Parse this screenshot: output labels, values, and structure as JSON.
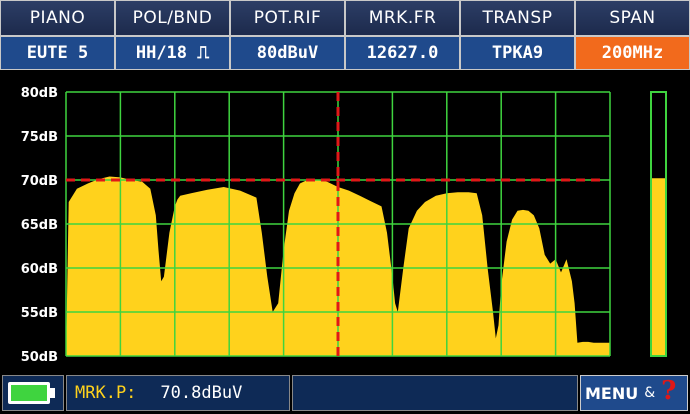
{
  "header": {
    "labels": [
      "PIANO",
      "POL/BND",
      "POT.RIF",
      "MRK.FR",
      "TRANSP",
      "SPAN"
    ],
    "values": [
      "EUTE 5",
      "HH/18 ⎍",
      "80dBuV",
      "12627.0",
      "TPKA9",
      "200MHz"
    ],
    "active_index": 5
  },
  "colors": {
    "active": "#f26a1c",
    "trace": "#ffd21c",
    "grid": "#3fd43f",
    "reference": "#e01818",
    "level_bar": "#ffd21c",
    "battery": "#3fd43f"
  },
  "chart_data": {
    "type": "area",
    "ylim": [
      50,
      80
    ],
    "ytick_labels": [
      "80dB",
      "75dB",
      "70dB",
      "65dB",
      "60dB",
      "55dB",
      "50dB"
    ],
    "yticks": [
      80,
      75,
      70,
      65,
      60,
      55,
      50
    ],
    "x_grid_divisions": 10,
    "reference_level": 70,
    "marker_position": 0.5,
    "level_bar_value": 70.2,
    "grid": true,
    "series": [
      {
        "x": [
          0,
          0.005,
          0.02,
          0.04,
          0.06,
          0.08,
          0.1,
          0.12,
          0.14,
          0.155,
          0.165,
          0.17,
          0.175,
          0.18,
          0.19,
          0.2,
          0.205,
          0.21,
          0.23,
          0.26,
          0.29,
          0.32,
          0.35,
          0.36,
          0.37,
          0.38,
          0.39,
          0.4,
          0.41,
          0.42,
          0.43,
          0.44,
          0.46,
          0.48,
          0.49,
          0.5,
          0.52,
          0.54,
          0.56,
          0.58,
          0.59,
          0.6,
          0.605,
          0.61,
          0.62,
          0.63,
          0.645,
          0.66,
          0.68,
          0.7,
          0.72,
          0.74,
          0.755,
          0.765,
          0.775,
          0.785,
          0.79,
          0.795,
          0.8,
          0.81,
          0.82,
          0.83,
          0.84,
          0.85,
          0.86,
          0.87,
          0.88,
          0.89,
          0.9,
          0.91,
          0.92,
          0.93,
          0.935,
          0.94,
          0.95,
          0.96,
          0.97,
          0.98,
          0.99,
          1.0
        ],
        "y": [
          50,
          67.5,
          69.0,
          69.6,
          70.1,
          70.4,
          70.3,
          70.0,
          69.8,
          69.0,
          66.0,
          62.0,
          58.5,
          59.0,
          64.0,
          67.0,
          67.8,
          68.2,
          68.5,
          68.9,
          69.2,
          68.8,
          68.0,
          64.0,
          59.0,
          55.0,
          56.0,
          62.0,
          66.5,
          68.5,
          69.6,
          69.9,
          70.0,
          69.8,
          69.5,
          69.2,
          68.8,
          68.2,
          67.6,
          67.0,
          64.0,
          59.0,
          56.0,
          55.0,
          60.0,
          64.5,
          66.5,
          67.5,
          68.2,
          68.5,
          68.6,
          68.6,
          68.5,
          66.0,
          60.0,
          55.0,
          52.0,
          53.5,
          58.0,
          63.0,
          65.5,
          66.5,
          66.6,
          66.5,
          66.0,
          64.5,
          61.5,
          60.5,
          61.0,
          59.5,
          61.0,
          58.5,
          56.0,
          51.5,
          51.6,
          51.6,
          51.5,
          51.5,
          51.5,
          51.5
        ]
      }
    ]
  },
  "statusbar": {
    "marker_label": "MRK.P:",
    "marker_value": "70.8dBuV",
    "menu_label": "MENU",
    "amp": "&",
    "help": "?"
  },
  "icons": [
    "battery-icon",
    "help-icon"
  ]
}
